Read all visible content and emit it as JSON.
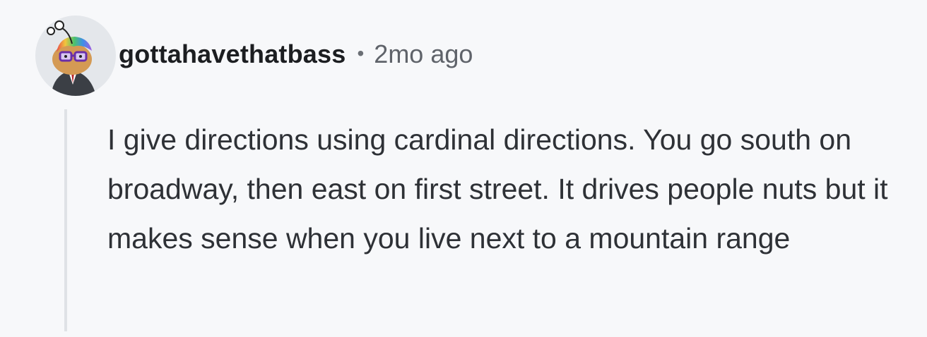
{
  "comment": {
    "author": "gottahavethatbass",
    "separator": "•",
    "timestamp": "2mo ago",
    "avatar_icon": "snoo-avatar-icon",
    "body": "I give directions using cardinal directions. You go south on broadway, then east on first street. It drives people nuts but it makes sense when you live next to a mountain range"
  },
  "colors": {
    "background": "#f7f8fa",
    "username": "#1c1e21",
    "meta": "#5f636a",
    "body": "#2e3136",
    "thread_line": "#dfe2e6"
  }
}
